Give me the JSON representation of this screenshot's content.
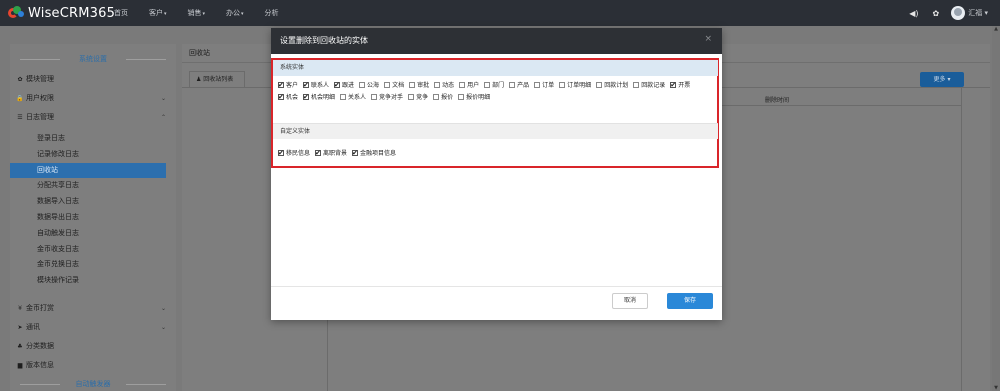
{
  "app": {
    "logo_text": "WiseCRM365"
  },
  "topnav": {
    "items": [
      {
        "label": "首页",
        "caret": ""
      },
      {
        "label": "客户",
        "caret": "▾"
      },
      {
        "label": "销售",
        "caret": "▾"
      },
      {
        "label": "办公",
        "caret": "▾"
      },
      {
        "label": "分析",
        "caret": ""
      }
    ],
    "user_name": "汇福 ▾"
  },
  "sidebar": {
    "section1": "系统设置",
    "items": [
      {
        "label": "模块管理",
        "icon": "gear-icon",
        "glyph": "✿"
      },
      {
        "label": "用户权限",
        "icon": "lock-icon",
        "glyph": "🔒",
        "chevron": "⌄"
      },
      {
        "label": "日志管理",
        "icon": "list-icon",
        "glyph": "☰",
        "chevron": "⌃"
      }
    ],
    "log_subitems": [
      "登录日志",
      "记录修改日志",
      "回收站",
      "分配共享日志",
      "数据导入日志",
      "数据导出日志",
      "自动触发日志",
      "金币收支日志",
      "金币兑换日志",
      "模块操作记录"
    ],
    "bottom_items": [
      {
        "label": "金币打赏",
        "glyph": "¥",
        "chevron": "⌄"
      },
      {
        "label": "通讯",
        "glyph": "➤",
        "chevron": "⌄"
      },
      {
        "label": "分类数据",
        "glyph": "♣"
      },
      {
        "label": "版本信息",
        "glyph": "▆"
      }
    ],
    "section2": "自动触发器"
  },
  "main": {
    "title": "回收站",
    "tab_label": "回收站列表",
    "more_button": "更多 ▾",
    "column_header": "删除时间"
  },
  "modal": {
    "title": "设置删除到回收站的实体",
    "close": "×",
    "system_group_label": "系统实体",
    "custom_group_label": "自定义实体",
    "system_entities": [
      {
        "label": "客户",
        "checked": true
      },
      {
        "label": "联系人",
        "checked": true
      },
      {
        "label": "跟进",
        "checked": true
      },
      {
        "label": "公海",
        "checked": false
      },
      {
        "label": "文档",
        "checked": false
      },
      {
        "label": "审批",
        "checked": false
      },
      {
        "label": "动态",
        "checked": false
      },
      {
        "label": "用户",
        "checked": false
      },
      {
        "label": "部门",
        "checked": false
      },
      {
        "label": "产品",
        "checked": false
      },
      {
        "label": "订单",
        "checked": false
      },
      {
        "label": "订单明细",
        "checked": false
      },
      {
        "label": "回款计划",
        "checked": false
      },
      {
        "label": "回款记录",
        "checked": false
      },
      {
        "label": "开票",
        "checked": true
      },
      {
        "label": "机会",
        "checked": true
      },
      {
        "label": "机会明细",
        "checked": true
      },
      {
        "label": "关系人",
        "checked": false
      },
      {
        "label": "竞争对手",
        "checked": false
      },
      {
        "label": "竞争",
        "checked": false
      },
      {
        "label": "报价",
        "checked": false
      },
      {
        "label": "报价明细",
        "checked": false
      }
    ],
    "custom_entities": [
      {
        "label": "移民信息",
        "checked": true
      },
      {
        "label": "离职背景",
        "checked": true
      },
      {
        "label": "金融项目信息",
        "checked": true
      }
    ],
    "cancel_label": "取消",
    "save_label": "保存"
  }
}
